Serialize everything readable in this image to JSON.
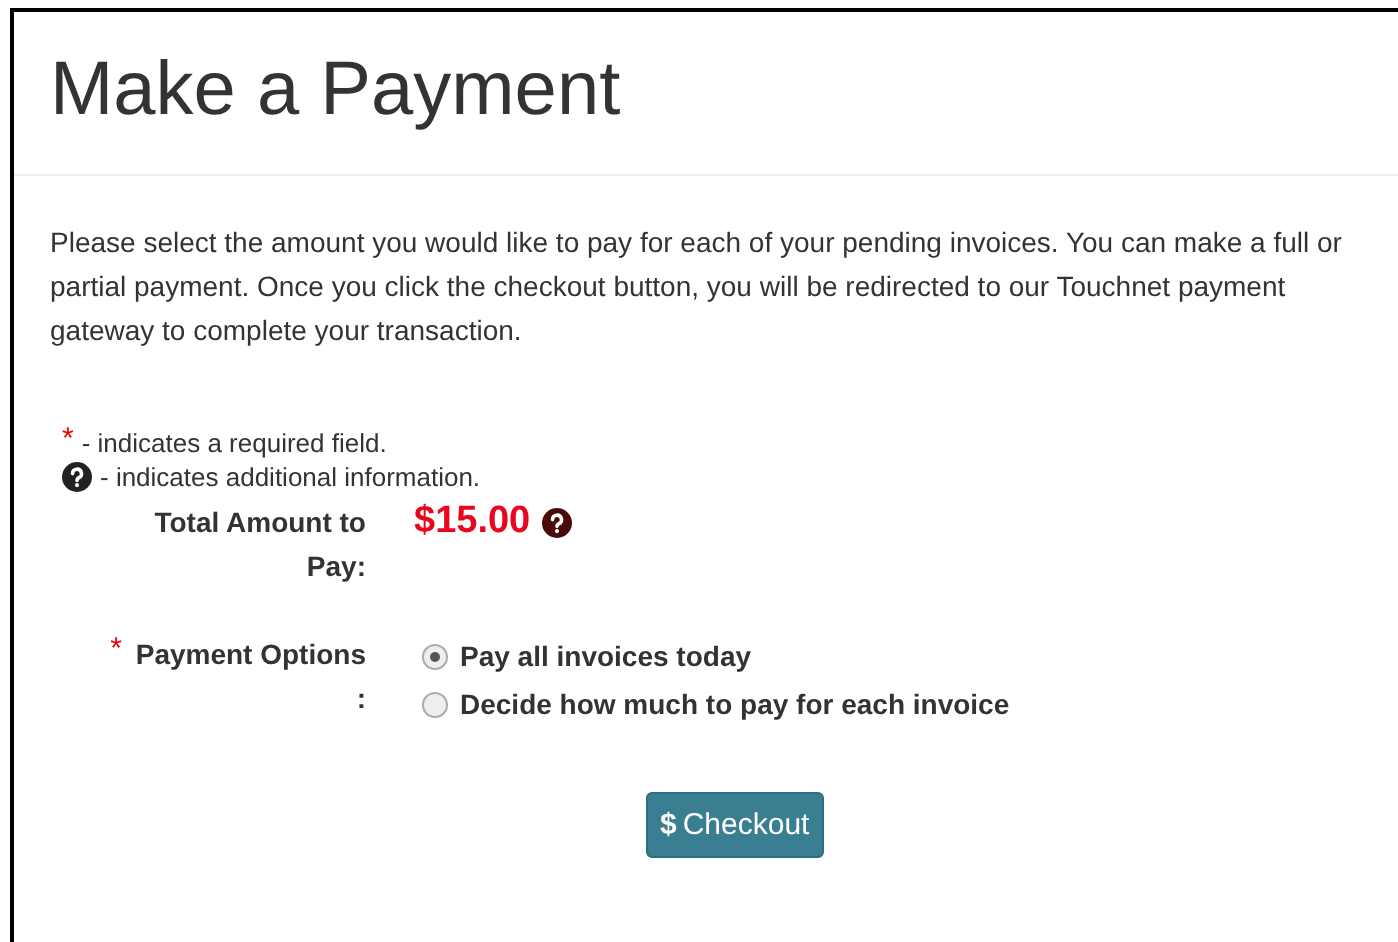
{
  "header": {
    "title": "Make a Payment"
  },
  "intro": "Please select the amount you would like to pay for each of your pending invoices. You can make a full or partial payment. Once you click the checkout button, you will be redirected to our Touchnet payment gateway to complete your transaction.",
  "legend": [
    {
      "kind": "required",
      "mark": "*",
      "text": "- indicates a required field."
    },
    {
      "kind": "info",
      "text": "- indicates additional information."
    }
  ],
  "total": {
    "label": "Total Amount to Pay:",
    "amount": "$15.00"
  },
  "payment_options": {
    "label": "Payment Options :",
    "required": true,
    "options": [
      {
        "label": "Pay all invoices today",
        "selected": true
      },
      {
        "label": "Decide how much to pay for each invoice",
        "selected": false
      }
    ]
  },
  "checkout_button": {
    "icon": "$",
    "label": "Checkout"
  }
}
